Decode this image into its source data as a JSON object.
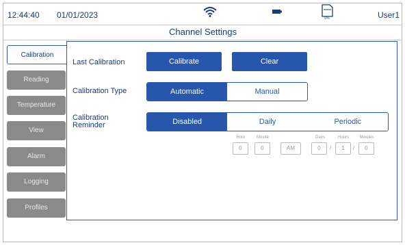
{
  "status": {
    "time": "12:44:40",
    "date": "01/01/2023",
    "user": "User1",
    "storage_percent": "0%",
    "icons": [
      "wifi-icon",
      "battery-icon",
      "sd-card-icon"
    ]
  },
  "page_title": "Channel Settings",
  "tabs": [
    {
      "label": "Calibration",
      "active": true
    },
    {
      "label": "Reading",
      "active": false
    },
    {
      "label": "Temperature",
      "active": false
    },
    {
      "label": "View",
      "active": false
    },
    {
      "label": "Alarm",
      "active": false
    },
    {
      "label": "Logging",
      "active": false
    },
    {
      "label": "Profiles",
      "active": false
    }
  ],
  "last_calibration": {
    "label": "Last Calibration",
    "calibrate_label": "Calibrate",
    "clear_label": "Clear"
  },
  "calibration_type": {
    "label": "Calibration Type",
    "options": [
      "Automatic",
      "Manual"
    ],
    "selected": "Automatic"
  },
  "reminder": {
    "label_line1": "Calibration",
    "label_line2": "Reminder",
    "options": [
      "Disabled",
      "Daily",
      "Periodic"
    ],
    "selected": "Disabled",
    "daily": {
      "hour_label": "Hour",
      "minute_label": "Minute",
      "hour": "0",
      "minute": "0",
      "ampm": "AM",
      "separator": ":"
    },
    "periodic": {
      "days_label": "Days",
      "hours_label": "Hours",
      "minutes_label": "Minutes",
      "days": "0",
      "hours": "1",
      "minutes": "0",
      "separator": "/"
    }
  },
  "colors": {
    "accent": "#2657ad",
    "text": "#1a3a7a",
    "inactive_tab": "#8a8a8a"
  }
}
